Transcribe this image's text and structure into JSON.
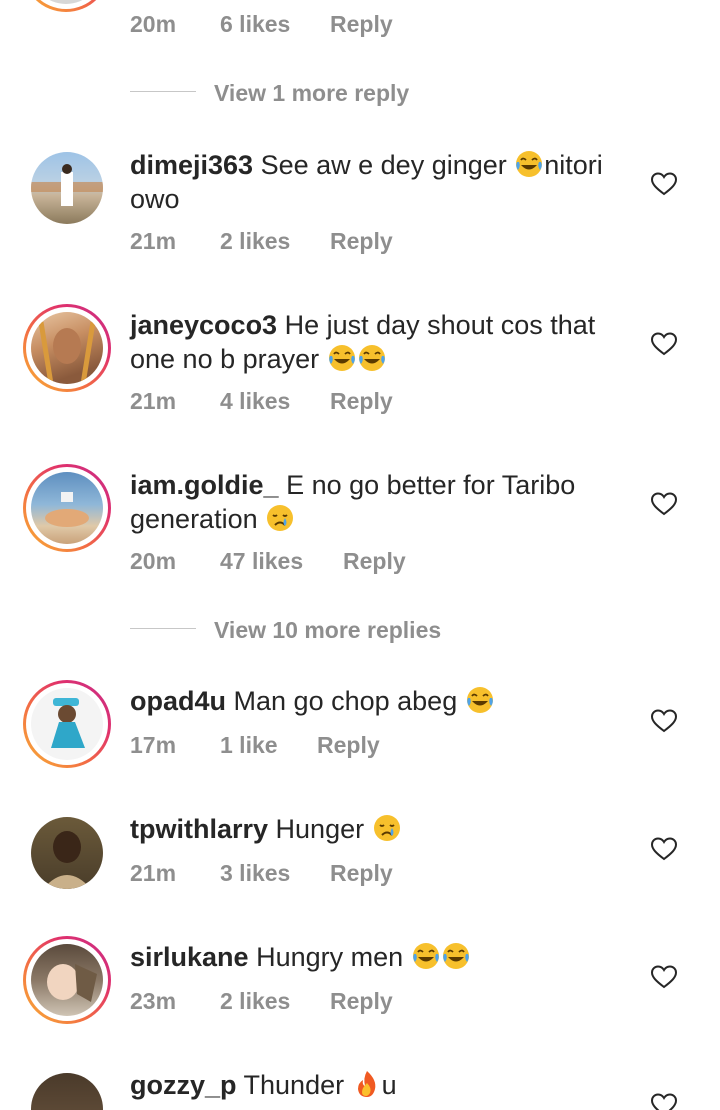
{
  "top_comment": {
    "time": "20m",
    "likes": "6 likes",
    "reply": "Reply"
  },
  "view_more_1": "View 1 more reply",
  "view_more_2": "View 10 more replies",
  "comments": [
    {
      "username": "dimeji363",
      "text_before": "See aw e dey ginger ",
      "emoji": "laughing-tears",
      "text_after": "nitori owo",
      "time": "21m",
      "likes": "2 likes",
      "reply": "Reply"
    },
    {
      "username": "janeycoco3",
      "text_before": "He just day shout cos that one no b prayer ",
      "emoji": "laughing-tears-x2",
      "text_after": "",
      "time": "21m",
      "likes": "4 likes",
      "reply": "Reply"
    },
    {
      "username": "iam.goldie_",
      "text_before": "E no go better for Taribo generation ",
      "emoji": "crying-face",
      "text_after": "",
      "time": "20m",
      "likes": "47 likes",
      "reply": "Reply"
    },
    {
      "username": "opad4u",
      "text_before": "Man go chop abeg ",
      "emoji": "laughing-tears",
      "text_after": "",
      "time": "17m",
      "likes": "1 like",
      "reply": "Reply"
    },
    {
      "username": "tpwithlarry",
      "text_before": "Hunger ",
      "emoji": "crying-face",
      "text_after": "",
      "time": "21m",
      "likes": "3 likes",
      "reply": "Reply"
    },
    {
      "username": "sirlukane",
      "text_before": "Hungry men ",
      "emoji": "laughing-tears-x2",
      "text_after": "",
      "time": "23m",
      "likes": "2 likes",
      "reply": "Reply"
    },
    {
      "username": "gozzy_p",
      "text_before": "Thunder ",
      "emoji": "fire",
      "text_after": "u",
      "time": "",
      "likes": "",
      "reply": ""
    }
  ],
  "colors": {
    "ring_start": "#f9b234",
    "ring_end": "#c42e8b",
    "meta_gray": "#8e8e8e"
  }
}
